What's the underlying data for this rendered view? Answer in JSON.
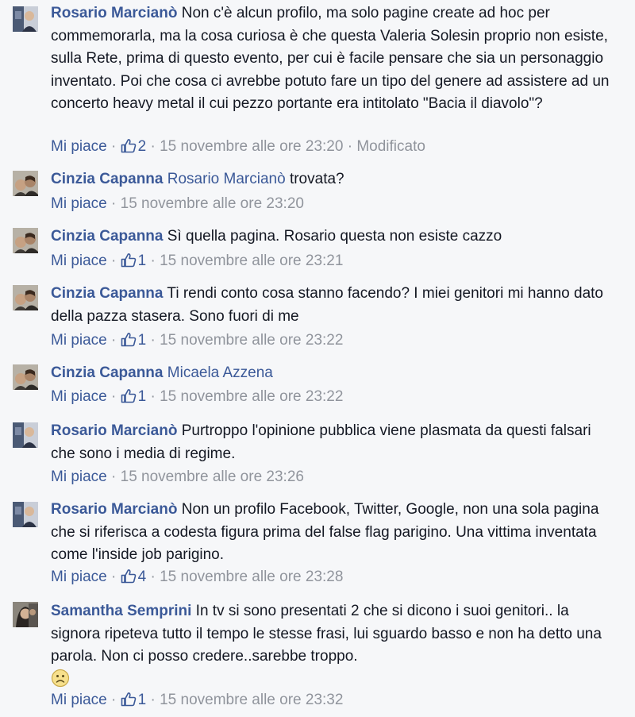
{
  "comments": [
    {
      "author": "Rosario Marcianò",
      "mention": "",
      "text": "Non c'è alcun profilo, ma solo pagine create ad hoc per commemorarla, ma la cosa curiosa è che questa Valeria Solesin proprio non esiste, sulla Rete, prima di questo evento, per cui è facile pensare che sia un personaggio inventato. Poi che cosa ci avrebbe potuto fare un tipo del genere ad assistere ad un concerto heavy metal il cui pezzo portante era intitolato \"Bacia il diavolo\"?",
      "like_label": "Mi piace",
      "likes": "2",
      "time": "15 novembre alle ore 23:20",
      "edited": "Modificato"
    },
    {
      "author": "Cinzia Capanna",
      "mention": "Rosario Marcianò",
      "text": "trovata?",
      "like_label": "Mi piace",
      "likes": "",
      "time": "15 novembre alle ore 23:20",
      "edited": ""
    },
    {
      "author": "Cinzia Capanna",
      "mention": "",
      "text": "Sì quella pagina. Rosario questa non esiste cazzo",
      "like_label": "Mi piace",
      "likes": "1",
      "time": "15 novembre alle ore 23:21",
      "edited": ""
    },
    {
      "author": "Cinzia Capanna",
      "mention": "",
      "text": "Ti rendi conto cosa stanno facendo? I miei genitori mi hanno dato della pazza stasera. Sono fuori di me",
      "like_label": "Mi piace",
      "likes": "1",
      "time": "15 novembre alle ore 23:22",
      "edited": ""
    },
    {
      "author": "Cinzia Capanna",
      "mention": "Micaela Azzena",
      "text": "",
      "like_label": "Mi piace",
      "likes": "1",
      "time": "15 novembre alle ore 23:22",
      "edited": ""
    },
    {
      "author": "Rosario Marcianò",
      "mention": "",
      "text": "Purtroppo l'opinione pubblica viene plasmata da questi falsari che sono i media di regime.",
      "like_label": "Mi piace",
      "likes": "",
      "time": "15 novembre alle ore 23:26",
      "edited": ""
    },
    {
      "author": "Rosario Marcianò",
      "mention": "",
      "text": "Non un profilo Facebook, Twitter, Google, non una sola pagina che si riferisca a codesta figura prima del false flag parigino. Una vittima inventata come l'inside job parigino.",
      "like_label": "Mi piace",
      "likes": "4",
      "time": "15 novembre alle ore 23:28",
      "edited": ""
    },
    {
      "author": "Samantha Semprini",
      "mention": "",
      "text": "In tv si sono presentati 2 che si dicono i suoi genitori.. la signora ripeteva tutto il tempo le stesse frasi, lui sguardo basso e non ha detto una parola. Non ci posso credere..sarebbe troppo.",
      "like_label": "Mi piace",
      "likes": "1",
      "time": "15 novembre alle ore 23:32",
      "edited": ""
    }
  ],
  "separator": "·",
  "emoji": "frown-emoji",
  "colors": {
    "link": "#3b5998",
    "text": "#141823",
    "meta": "#90949c",
    "background": "#f6f7f9"
  }
}
